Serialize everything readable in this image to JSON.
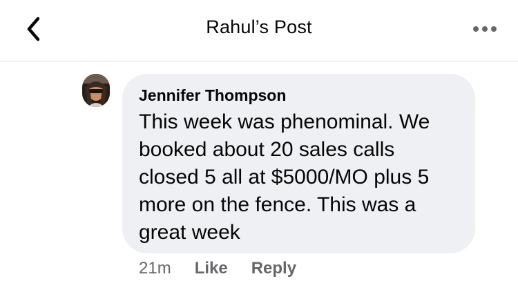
{
  "header": {
    "title": "Rahul’s Post",
    "back_icon": "chevron-left-icon",
    "more_icon": "more-horizontal-icon"
  },
  "comment": {
    "author": "Jennifer Thompson",
    "text": "This week was phenominal. We booked about 20 sales calls closed 5 all at $5000/MO plus 5 more on the fence. This was a great week",
    "time": "21m",
    "like_label": "Like",
    "reply_label": "Reply"
  },
  "colors": {
    "bubble": "#eef0f3",
    "meta_text": "#65676b",
    "divider": "#dadde1"
  }
}
